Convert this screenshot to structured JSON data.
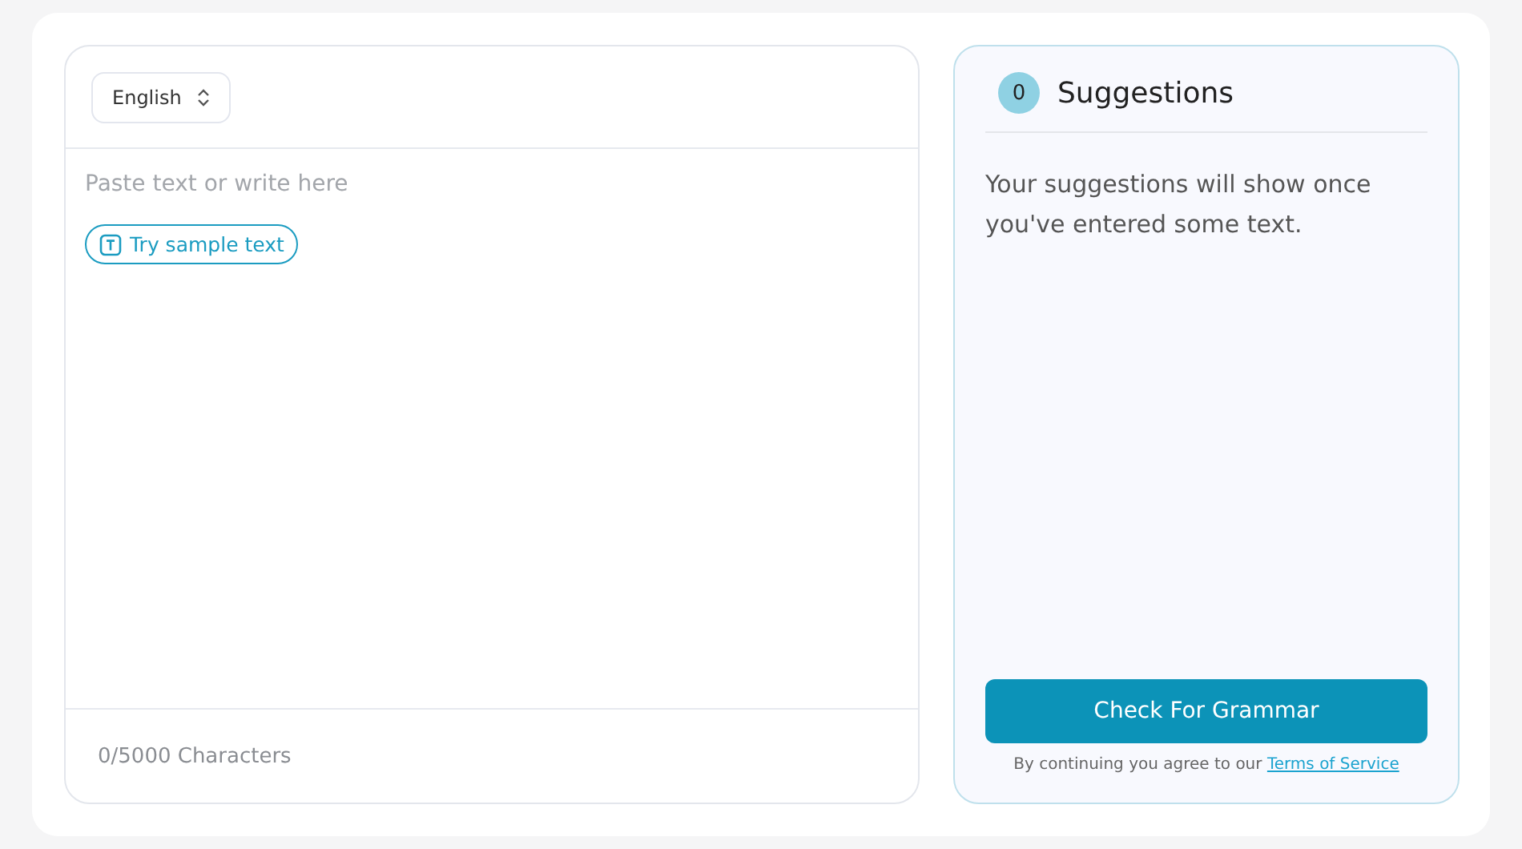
{
  "editor": {
    "language": "English",
    "placeholder": "Paste text or write here",
    "sample_button": "Try sample text",
    "counter": "0/5000 Characters"
  },
  "suggestions": {
    "count": "0",
    "title": "Suggestions",
    "message": "Your suggestions will show once you've entered some text.",
    "button": "Check For Grammar",
    "terms_text": "By continuing you agree to our ",
    "terms_link": "Terms of Service"
  }
}
